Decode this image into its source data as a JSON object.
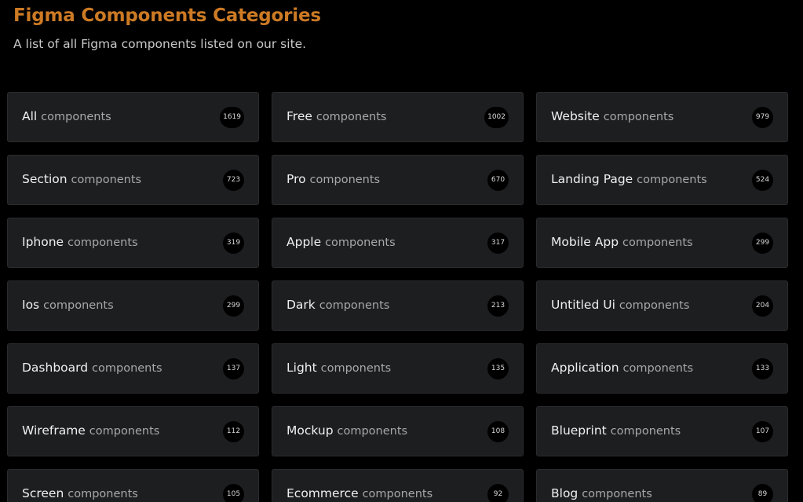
{
  "header": {
    "title": "Figma Components Categories",
    "subtitle": "A list of all Figma components listed on our site."
  },
  "colors": {
    "accent": "#cc7a24",
    "background": "#000000",
    "card": "#1d1e20"
  },
  "suffix": "components",
  "categories": [
    {
      "name": "All",
      "count": "1619"
    },
    {
      "name": "Free",
      "count": "1002"
    },
    {
      "name": "Website",
      "count": "979"
    },
    {
      "name": "Section",
      "count": "723"
    },
    {
      "name": "Pro",
      "count": "670"
    },
    {
      "name": "Landing Page",
      "count": "524"
    },
    {
      "name": "Iphone",
      "count": "319"
    },
    {
      "name": "Apple",
      "count": "317"
    },
    {
      "name": "Mobile App",
      "count": "299"
    },
    {
      "name": "Ios",
      "count": "299"
    },
    {
      "name": "Dark",
      "count": "213"
    },
    {
      "name": "Untitled Ui",
      "count": "204"
    },
    {
      "name": "Dashboard",
      "count": "137"
    },
    {
      "name": "Light",
      "count": "135"
    },
    {
      "name": "Application",
      "count": "133"
    },
    {
      "name": "Wireframe",
      "count": "112"
    },
    {
      "name": "Mockup",
      "count": "108"
    },
    {
      "name": "Blueprint",
      "count": "107"
    },
    {
      "name": "Screen",
      "count": "105"
    },
    {
      "name": "Ecommerce",
      "count": "92"
    },
    {
      "name": "Blog",
      "count": "89"
    }
  ]
}
